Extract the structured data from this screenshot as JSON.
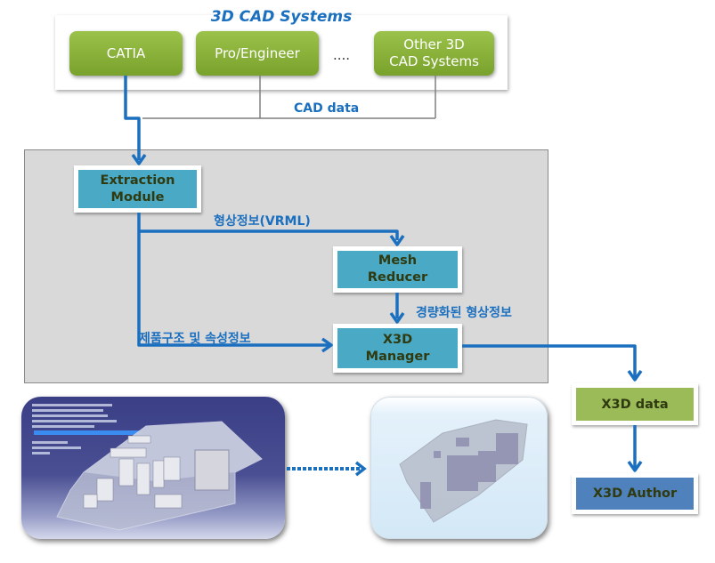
{
  "cad_systems": {
    "title": "3D CAD Systems",
    "systems": [
      "CATIA",
      "Pro/Engineer",
      "Other 3D\nCAD Systems"
    ],
    "ellipsis": "....",
    "output_label": "CAD data"
  },
  "processing": {
    "extraction_module": "Extraction Module",
    "mesh_reducer": "Mesh Reducer",
    "x3d_manager": "X3D Manager",
    "labels": {
      "shape_info_vrml": "형상정보(VRML)",
      "lightweight_shape_info": "경량화된 형상정보",
      "product_structure_attributes": "제품구조 및 속성정보"
    }
  },
  "outputs": {
    "x3d_data": "X3D data",
    "x3d_author": "X3D Author"
  },
  "images": {
    "source_model": "CATIA 3D model screenshot",
    "converted_model": "X3D lightweight model screenshot"
  },
  "colors": {
    "arrow_blue": "#1b6fbf",
    "cad_green": "#8ab43b",
    "module_teal": "#4aaac6",
    "x3d_data_green": "#9bbb59",
    "x3d_author_blue": "#4f81bd",
    "panel_gray": "#d9d9d9"
  }
}
